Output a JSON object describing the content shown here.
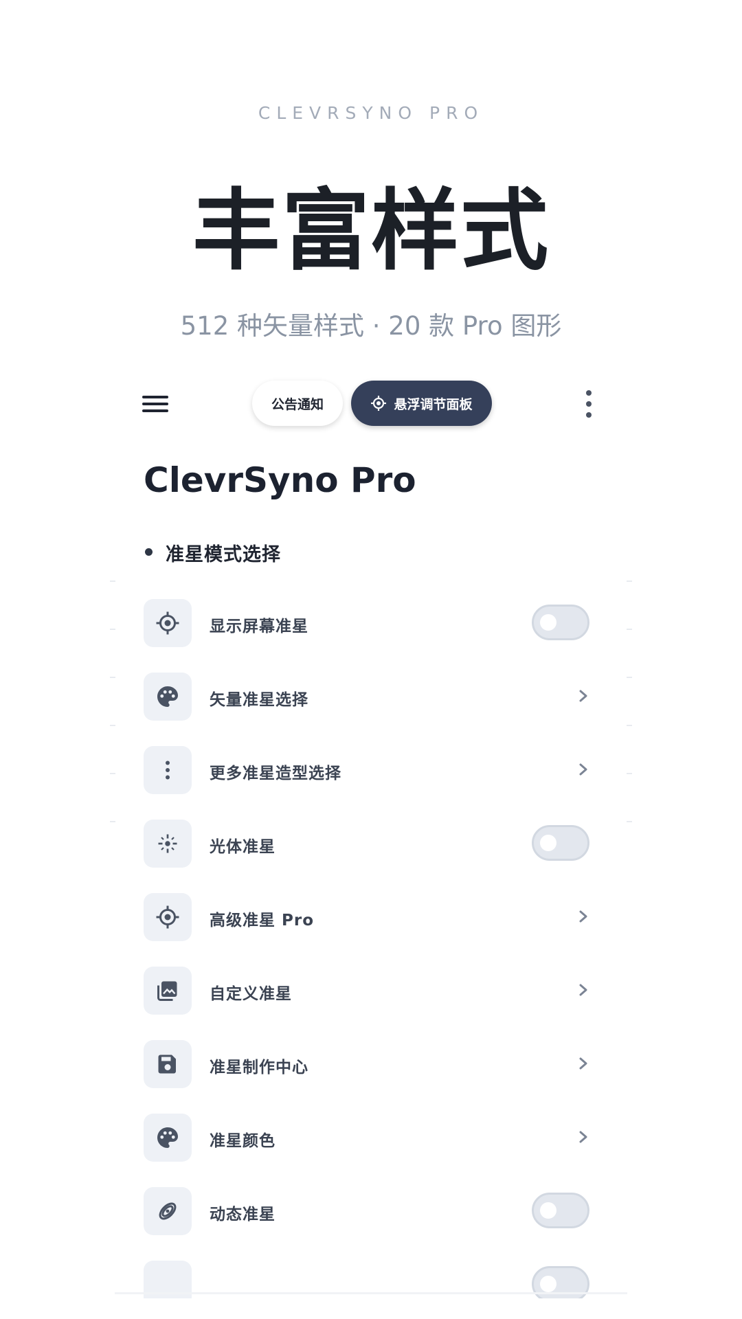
{
  "header": {
    "brand": "CLEVRSYNO PRO",
    "hero_title": "丰富样式",
    "subtitle": "512 种矢量样式 · 20 款 Pro 图形"
  },
  "toolbar": {
    "notice_label": "公告通知",
    "float_panel_label": "悬浮调节面板"
  },
  "app": {
    "title": "ClevrSyno Pro",
    "section_title": "准星模式选择"
  },
  "settings": [
    {
      "label": "显示屏幕准星",
      "icon": "crosshair-icon",
      "control": "toggle",
      "on": false
    },
    {
      "label": "矢量准星选择",
      "icon": "palette-icon",
      "control": "chevron"
    },
    {
      "label": "更多准星造型选择",
      "icon": "more-vertical-icon",
      "control": "chevron"
    },
    {
      "label": "光体准星",
      "icon": "glow-icon",
      "control": "toggle",
      "on": false
    },
    {
      "label": "高级准星 Pro",
      "icon": "crosshair-icon",
      "control": "chevron"
    },
    {
      "label": "自定义准星",
      "icon": "image-icon",
      "control": "chevron"
    },
    {
      "label": "准星制作中心",
      "icon": "save-icon",
      "control": "chevron"
    },
    {
      "label": "准星颜色",
      "icon": "palette-icon",
      "control": "chevron"
    },
    {
      "label": "动态准星",
      "icon": "dynamic-icon",
      "control": "toggle",
      "on": false
    }
  ],
  "colors": {
    "accent_dark": "#35405a",
    "icon_bg": "#eef1f6",
    "toggle_off": "#e3e7ee"
  }
}
